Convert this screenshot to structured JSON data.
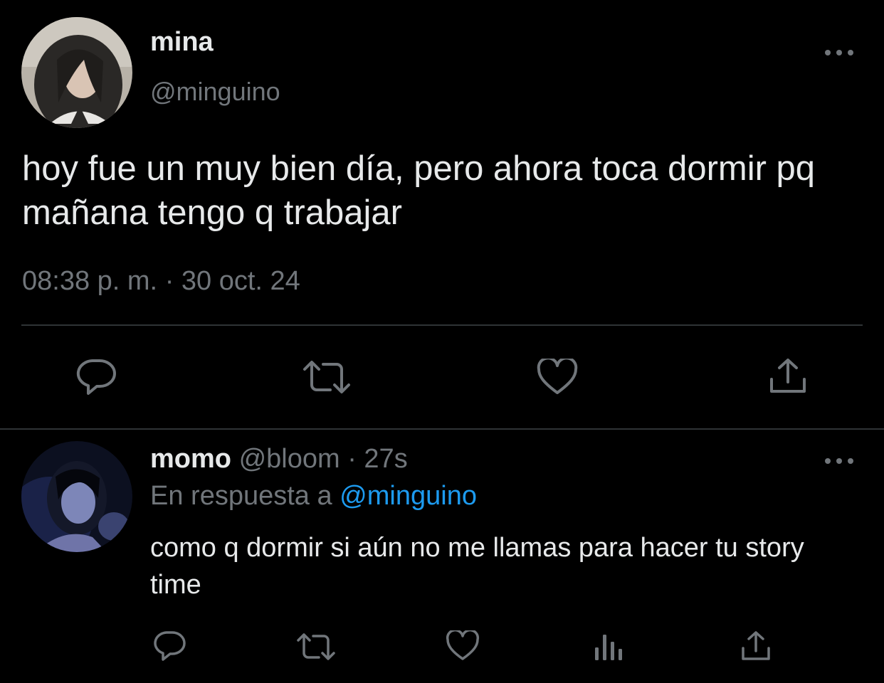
{
  "main_tweet": {
    "display_name": "mina",
    "handle": "@minguino",
    "text": "hoy fue un muy bien día, pero ahora toca dormir pq mañana tengo q trabajar",
    "time": "08:38 p. m.",
    "separator": "·",
    "date": "30 oct. 24",
    "actions": [
      "reply-icon",
      "retweet-icon",
      "like-icon",
      "share-icon"
    ]
  },
  "reply_tweet": {
    "display_name": "momo",
    "handle": "@bloom",
    "separator": "·",
    "age": "27s",
    "context_prefix": "En respuesta a",
    "context_mention": "@minguino",
    "text": "como q dormir si aún no me llamas para hacer tu story time",
    "actions": [
      "reply-icon",
      "retweet-icon",
      "like-icon",
      "analytics-icon",
      "share-icon"
    ]
  },
  "colors": {
    "background": "#000000",
    "text_primary": "#e7e9ea",
    "text_secondary": "#71767b",
    "icon": "#71767b",
    "link": "#1d9bf0",
    "divider": "#2f3336"
  }
}
